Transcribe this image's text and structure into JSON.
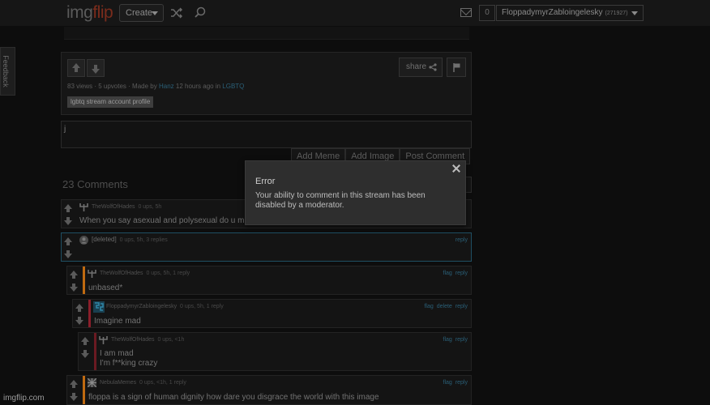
{
  "header": {
    "logo_main": "img",
    "logo_accent": "flip",
    "create_label": "Create",
    "notif_count": "0",
    "username": "FloppadymyrZabloingelesky",
    "user_points": "(271927)"
  },
  "feedback_label": "Feedback",
  "post": {
    "views": "83 views",
    "upvotes": "5 upvotes",
    "made_by_prefix": "Made by",
    "author": "Hanz",
    "time": "12 hours ago in",
    "stream": "LGBTQ",
    "tag": "lgbtq stream account profile",
    "share_label": "share"
  },
  "comment_box": {
    "value": "j",
    "buttons": [
      "Add Meme",
      "Add Image",
      "Post Comment"
    ]
  },
  "comments_title": "23 Comments",
  "comments": [
    {
      "user": "TheWolfOfHades",
      "meta": "0 ups, 5h",
      "lines": [
        "When you say asexual and polysexual do u m"
      ],
      "actions": [],
      "bar": ""
    },
    {
      "user": "[deleted]",
      "meta": "0 ups, 5h, 3 replies",
      "lines": [
        ""
      ],
      "actions": [
        "reply"
      ],
      "bar": ""
    },
    {
      "user": "TheWolfOfHades",
      "meta": "0 ups, 5h, 1 reply",
      "lines": [
        "unbased*"
      ],
      "actions": [
        "flag",
        "reply"
      ],
      "bar": "#c06a10"
    },
    {
      "user": "FloppadymyrZabloingelesky",
      "meta": "0 ups, 5h, 1 reply",
      "lines": [
        "Imagine mad"
      ],
      "actions": [
        "flag",
        "delete",
        "reply"
      ],
      "bar": "#8a1e2a"
    },
    {
      "user": "TheWolfOfHades",
      "meta": "0 ups, <1h",
      "lines": [
        "I am mad",
        "I'm f**king crazy"
      ],
      "actions": [
        "flag",
        "reply"
      ],
      "bar": "#6a1a22"
    },
    {
      "user": "NebulaMemes",
      "meta": "0 ups, <1h, 1 reply",
      "lines": [
        "floppa is a sign of human dignity how dare you disgrace the world with this image"
      ],
      "actions": [
        "flag",
        "reply"
      ],
      "bar": "#c06a10"
    }
  ],
  "modal": {
    "title": "Error",
    "message": "Your ability to comment in this stream has been disabled by a moderator."
  },
  "watermark": "imgflip.com",
  "colors": {
    "link": "#2a5f77",
    "orange_bar": "#c06a10",
    "red_bar": "#8a1e2a",
    "selected_border": "#1f4f63"
  }
}
